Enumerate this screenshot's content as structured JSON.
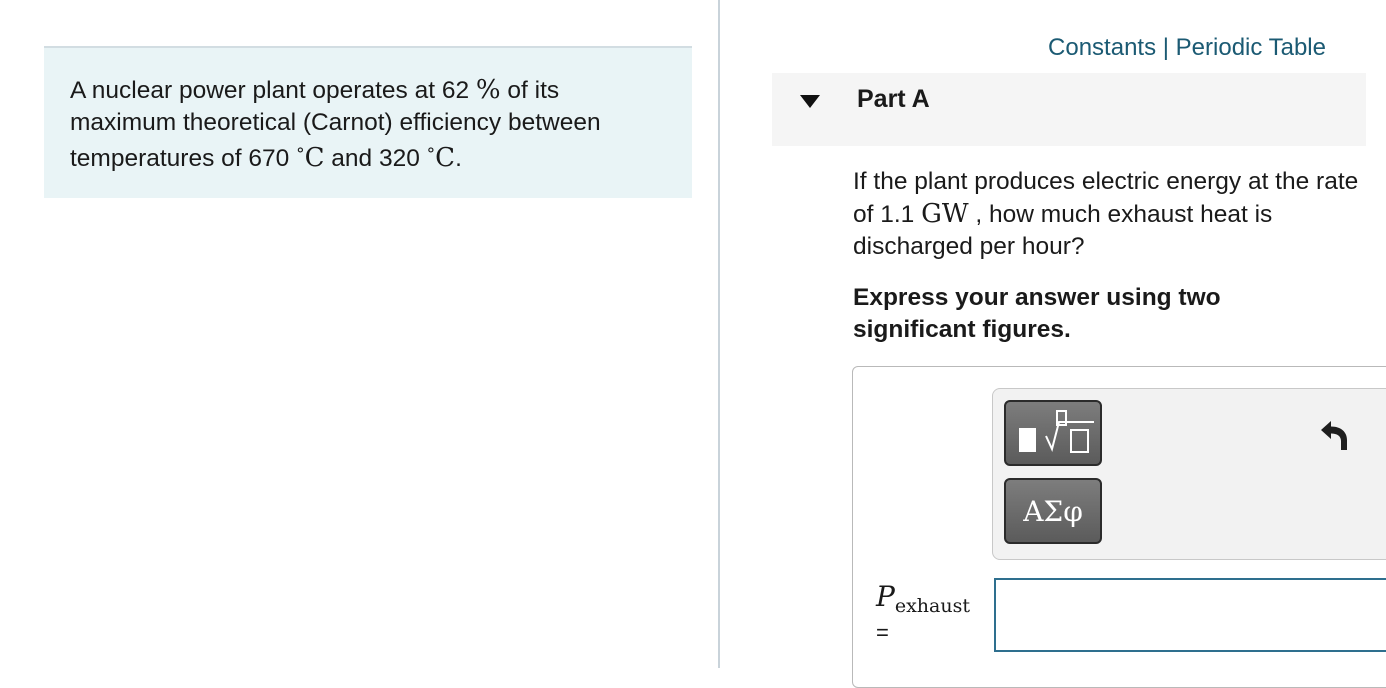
{
  "problem": {
    "intro_1": "A nuclear power plant operates at 62 ",
    "percent": "%",
    "intro_2": " of its maximum theoretical (Carnot) efficiency between temperatures of 670 ",
    "deg1": "°",
    "c1": "C",
    "intro_3": " and 320 ",
    "deg2": "°",
    "c2": "C",
    "intro_4": "."
  },
  "links": {
    "constants": "Constants",
    "separator": " | ",
    "periodic_table": "Periodic Table"
  },
  "part": {
    "title": "Part A"
  },
  "question": {
    "text_1": "If the plant produces electric energy at the rate of 1.1 ",
    "unit": "GW",
    "text_2": " , how much exhaust heat is discharged per hour?"
  },
  "instruction": "Express your answer using two significant figures.",
  "toolbar": {
    "symbols_label": "ΑΣφ"
  },
  "answer": {
    "var_symbol": "P",
    "var_subscript": "exhaust",
    "equals": "=",
    "value": ""
  },
  "colors": {
    "link": "#1b5a73",
    "intro_bg": "#e9f4f6",
    "input_border": "#2e6f8e"
  }
}
